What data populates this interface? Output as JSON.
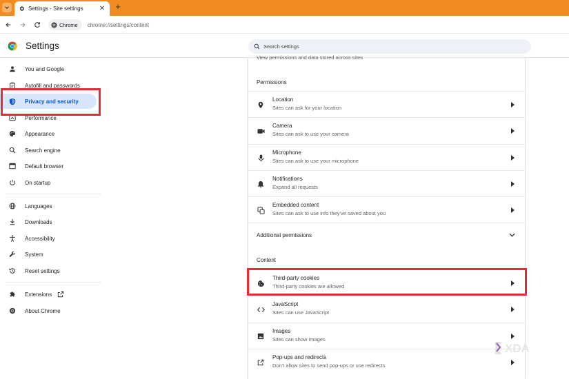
{
  "browser": {
    "tab_title": "Settings - Site settings",
    "new_tab_label": "+",
    "close_label": "✕",
    "chip_label": "Chrome",
    "url": "chrome://settings/content"
  },
  "header": {
    "title": "Settings",
    "search_placeholder": "Search settings"
  },
  "sidebar": {
    "items": [
      {
        "label": "You and Google",
        "icon": "person-icon"
      },
      {
        "label": "Autofill and passwords",
        "icon": "clipboard-icon"
      },
      {
        "label": "Privacy and security",
        "icon": "shield-icon",
        "active": true
      },
      {
        "label": "Performance",
        "icon": "speedometer-icon"
      },
      {
        "label": "Appearance",
        "icon": "palette-icon"
      },
      {
        "label": "Search engine",
        "icon": "search-icon"
      },
      {
        "label": "Default browser",
        "icon": "browser-icon"
      },
      {
        "label": "On startup",
        "icon": "power-icon"
      },
      {
        "label": "Languages",
        "icon": "globe-icon"
      },
      {
        "label": "Downloads",
        "icon": "download-icon"
      },
      {
        "label": "Accessibility",
        "icon": "accessibility-icon"
      },
      {
        "label": "System",
        "icon": "wrench-icon"
      },
      {
        "label": "Reset settings",
        "icon": "history-icon"
      },
      {
        "label": "Extensions",
        "icon": "puzzle-icon"
      },
      {
        "label": "About Chrome",
        "icon": "chrome-logo-icon"
      }
    ]
  },
  "content": {
    "cut_text": "View permissions and data stored across sites",
    "permissions_heading": "Permissions",
    "permissions": [
      {
        "title": "Location",
        "subtitle": "Sites can ask for your location",
        "icon": "location-pin-icon"
      },
      {
        "title": "Camera",
        "subtitle": "Sites can ask to use your camera",
        "icon": "camera-icon"
      },
      {
        "title": "Microphone",
        "subtitle": "Sites can ask to use your microphone",
        "icon": "microphone-icon"
      },
      {
        "title": "Notifications",
        "subtitle": "Expand all requests",
        "icon": "bell-icon"
      },
      {
        "title": "Embedded content",
        "subtitle": "Sites can ask to use info they've saved about you",
        "icon": "embedded-content-icon"
      }
    ],
    "additional_permissions": "Additional permissions",
    "content_heading": "Content",
    "content_items": [
      {
        "title": "Third-party cookies",
        "subtitle": "Third-party cookies are allowed",
        "icon": "cookie-icon"
      },
      {
        "title": "JavaScript",
        "subtitle": "Sites can use JavaScript",
        "icon": "code-icon"
      },
      {
        "title": "Images",
        "subtitle": "Sites can show images",
        "icon": "image-icon"
      },
      {
        "title": "Pop-ups and redirects",
        "subtitle": "Don't allow sites to send pop-ups or use redirects",
        "icon": "open-in-new-icon"
      }
    ]
  },
  "watermark": {
    "text": "XDA"
  },
  "colors": {
    "tab_strip": "#f28c22",
    "highlight": "#e32d35",
    "active_nav_bg": "#d7e6fb",
    "active_nav_text": "#0b57d0",
    "search_bg": "#eef2f8"
  }
}
